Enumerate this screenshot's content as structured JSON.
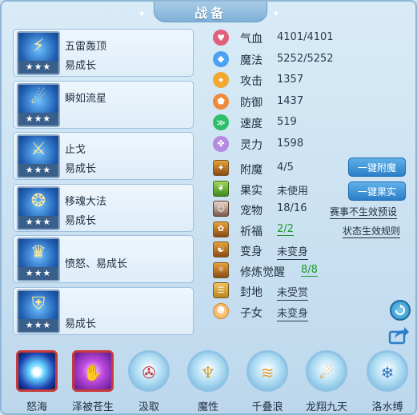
{
  "title": "战备",
  "skills": [
    {
      "name": "五雷轰顶",
      "sub": "易成长",
      "stars": "★★★"
    },
    {
      "name": "瞬如流星",
      "sub": "",
      "stars": "★★★"
    },
    {
      "name": "止戈",
      "sub": "易成长",
      "stars": "★★★"
    },
    {
      "name": "移魂大法",
      "sub": "易成长",
      "stars": "★★★"
    },
    {
      "name": "",
      "sub": "愤怒、易成长",
      "stars": "★★★"
    },
    {
      "name": "",
      "sub": "易成长",
      "stars": "★★★"
    }
  ],
  "stats": [
    {
      "label": "气血",
      "value": "4101/4101",
      "icon": "heart-icon",
      "color": "#e0607a",
      "glyph": "♥"
    },
    {
      "label": "魔法",
      "value": "5252/5252",
      "icon": "mana-icon",
      "color": "#4aa3f0",
      "glyph": "◆"
    },
    {
      "label": "攻击",
      "value": "1357",
      "icon": "attack-icon",
      "color": "#f0a830",
      "glyph": "✦"
    },
    {
      "label": "防御",
      "value": "1437",
      "icon": "defense-icon",
      "color": "#f08a3a",
      "glyph": "⬟"
    },
    {
      "label": "速度",
      "value": "519",
      "icon": "speed-icon",
      "color": "#2fbf6a",
      "glyph": "≫"
    },
    {
      "label": "灵力",
      "value": "1598",
      "icon": "spirit-icon",
      "color": "#b58ae0",
      "glyph": "✤"
    }
  ],
  "extras": [
    {
      "label": "附魔",
      "value": "4/5",
      "icon": "enchant-icon",
      "style": "plain"
    },
    {
      "label": "果实",
      "value": "未使用",
      "icon": "fruit-icon",
      "style": "plain"
    },
    {
      "label": "宠物",
      "value": "18/16",
      "icon": "pet-icon",
      "style": "plain"
    },
    {
      "label": "祈福",
      "value": "2/2",
      "icon": "blessing-icon",
      "style": "green"
    },
    {
      "label": "变身",
      "value": "未变身",
      "icon": "transform-icon",
      "style": "ul"
    },
    {
      "label": "修炼觉醒",
      "value": "8/8",
      "icon": "cultivation-icon",
      "style": "green-long"
    },
    {
      "label": "封地",
      "value": "未受赏",
      "icon": "fief-icon",
      "style": "ul"
    },
    {
      "label": "子女",
      "value": "未变身",
      "icon": "child-icon",
      "style": "ul"
    }
  ],
  "buttons": {
    "enchant": "一键附魔",
    "fruit": "一键果实"
  },
  "links": {
    "tournament_preset": "赛事不生效预设",
    "status_rules": "状态生效规则"
  },
  "bottom_slots": [
    {
      "label": "怒海",
      "icon": "angry-sea-icon",
      "shape": "square",
      "underline": true,
      "glyph": "✺"
    },
    {
      "label": "泽被苍生",
      "icon": "blessing-palm-icon",
      "shape": "square",
      "underline": true,
      "glyph": "✋"
    },
    {
      "label": "汲取",
      "icon": "absorb-icon",
      "shape": "round",
      "underline": false,
      "glyph": "✇"
    },
    {
      "label": "魔性",
      "icon": "demonic-icon",
      "shape": "round",
      "underline": false,
      "glyph": "♆"
    },
    {
      "label": "千叠浪",
      "icon": "wave-icon",
      "shape": "round",
      "underline": false,
      "glyph": "≋"
    },
    {
      "label": "龙翔九天",
      "icon": "dragon-icon",
      "shape": "round",
      "underline": false,
      "glyph": "☄"
    },
    {
      "label": "洛水缚",
      "icon": "water-bind-icon",
      "shape": "round",
      "underline": false,
      "glyph": "❄"
    }
  ]
}
